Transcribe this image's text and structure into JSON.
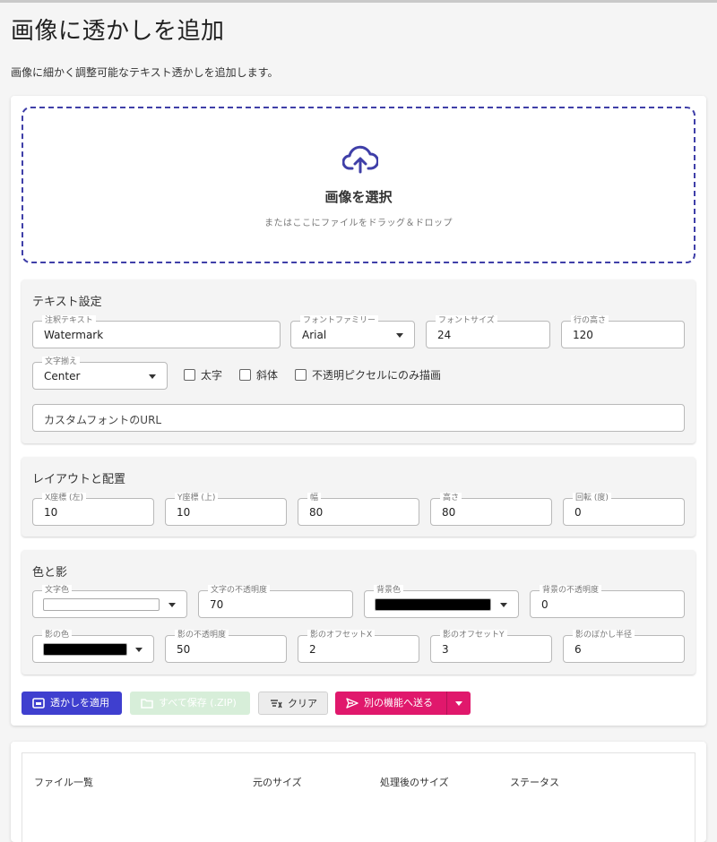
{
  "page": {
    "title": "画像に透かしを追加",
    "description": "画像に細かく調整可能なテキスト透かしを追加します。"
  },
  "upload": {
    "title": "画像を選択",
    "subtitle": "またはここにファイルをドラッグ＆ドロップ",
    "icon": "cloud-upload-icon",
    "accent": "#3f3fa8"
  },
  "text_settings": {
    "title": "テキスト設定",
    "annotation_text": {
      "label": "注釈テキスト",
      "value": "Watermark"
    },
    "font_family": {
      "label": "フォントファミリー",
      "value": "Arial"
    },
    "font_size": {
      "label": "フォントサイズ",
      "value": "24"
    },
    "line_height": {
      "label": "行の高さ",
      "value": "120"
    },
    "text_align": {
      "label": "文字揃え",
      "value": "Center"
    },
    "bold": {
      "label": "太字",
      "checked": false
    },
    "italic": {
      "label": "斜体",
      "checked": false
    },
    "opaque_only": {
      "label": "不透明ピクセルにのみ描画",
      "checked": false
    },
    "custom_font_url": {
      "placeholder": "カスタムフォントのURL"
    }
  },
  "layout": {
    "title": "レイアウトと配置",
    "x": {
      "label": "X座標 (左)",
      "value": "10"
    },
    "y": {
      "label": "Y座標 (上)",
      "value": "10"
    },
    "width": {
      "label": "幅",
      "value": "80"
    },
    "height": {
      "label": "高さ",
      "value": "80"
    },
    "rotation": {
      "label": "回転 (度)",
      "value": "0"
    }
  },
  "color_shadow": {
    "title": "色と影",
    "text_color": {
      "label": "文字色",
      "color": "#ffffff"
    },
    "text_opacity": {
      "label": "文字の不透明度",
      "value": "70"
    },
    "bg_color": {
      "label": "背景色",
      "color": "#000000"
    },
    "bg_opacity": {
      "label": "背景の不透明度",
      "value": "0"
    },
    "shadow_color": {
      "label": "影の色",
      "color": "#000000"
    },
    "shadow_opacity": {
      "label": "影の不透明度",
      "value": "50"
    },
    "shadow_offset_x": {
      "label": "影のオフセットX",
      "value": "2"
    },
    "shadow_offset_y": {
      "label": "影のオフセットY",
      "value": "3"
    },
    "shadow_blur": {
      "label": "影のぼかし半径",
      "value": "6"
    }
  },
  "actions": {
    "apply": {
      "label": "透かしを適用",
      "icon": "image-icon"
    },
    "save_all": {
      "label": "すべて保存 (.ZIP)",
      "icon": "folder-icon",
      "disabled": true
    },
    "clear": {
      "label": "クリア",
      "icon": "clear-icon"
    },
    "send": {
      "label": "別の機能へ送る",
      "icon": "send-icon"
    }
  },
  "file_table": {
    "columns": [
      "ファイル一覧",
      "元のサイズ",
      "処理後のサイズ",
      "ステータス"
    ]
  }
}
